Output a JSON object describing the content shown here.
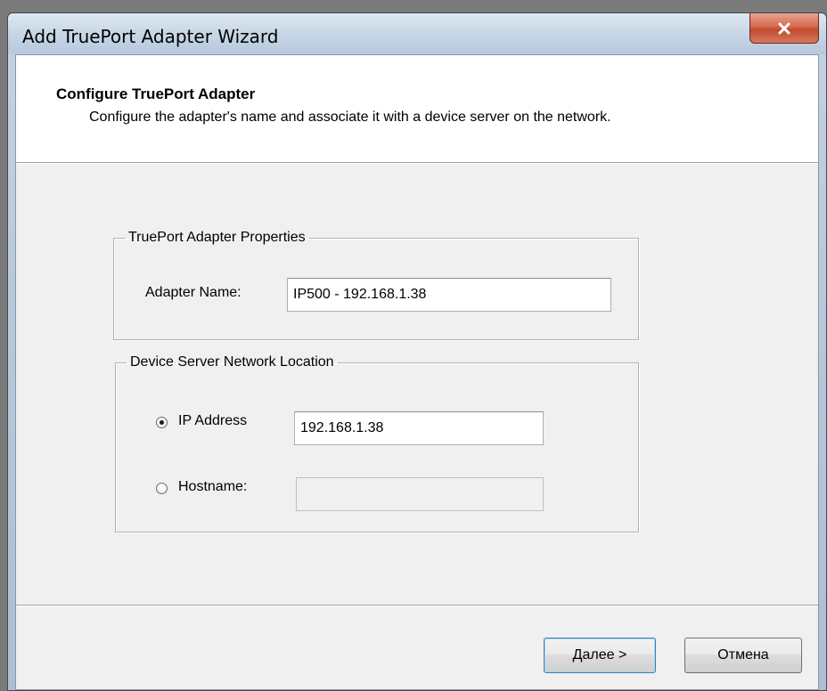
{
  "window": {
    "title": "Add TruePort Adapter Wizard",
    "close_glyph": "✕"
  },
  "header": {
    "title": "Configure TruePort Adapter",
    "subtitle": "Configure the adapter's name and associate it with a device server on the network."
  },
  "adapter_group": {
    "legend": "TruePort Adapter Properties",
    "name_label": "Adapter Name:",
    "name_value": "IP500 - 192.168.1.38"
  },
  "location_group": {
    "legend": "Device Server Network Location",
    "ip_label": "IP Address",
    "ip_value": "192.168.1.38",
    "ip_selected": true,
    "hostname_label": "Hostname:",
    "hostname_value": "",
    "hostname_selected": false
  },
  "buttons": {
    "next": "Далее >",
    "cancel": "Отмена"
  },
  "colors": {
    "close_button": "#c24a2e",
    "dialog_background": "#f0f0f0",
    "header_background": "#ffffff"
  }
}
